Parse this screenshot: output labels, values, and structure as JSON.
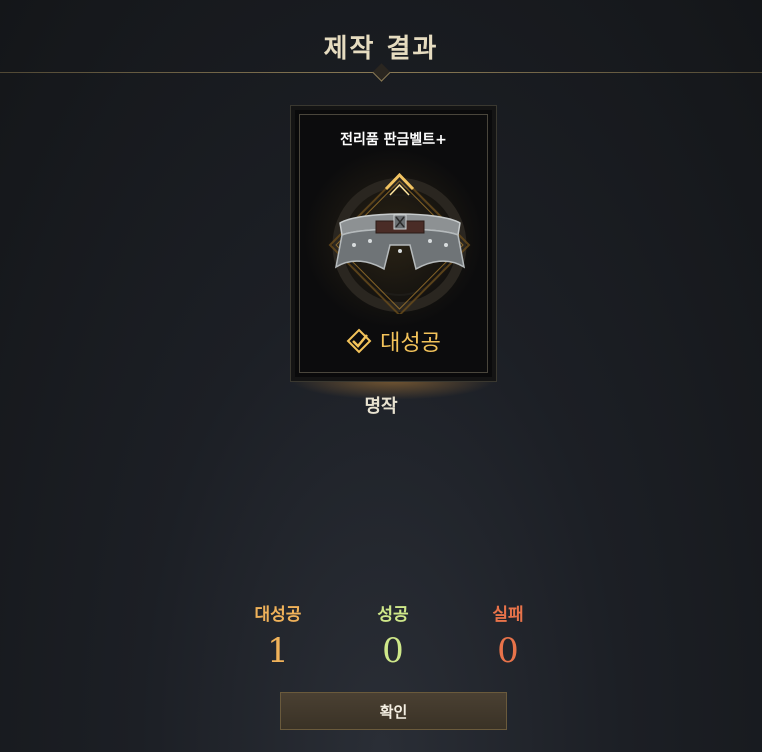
{
  "header": {
    "title": "제작 결과"
  },
  "item": {
    "name": "전리품 판금벨트+",
    "icon": "plate-belt-icon",
    "result_label": "대성공",
    "grade": "명작"
  },
  "stats": {
    "great_success": {
      "label": "대성공",
      "value": "1",
      "color": "#f0b25a"
    },
    "success": {
      "label": "성공",
      "value": "0",
      "color": "#cfe88a"
    },
    "failure": {
      "label": "실패",
      "value": "0",
      "color": "#e8734a"
    }
  },
  "actions": {
    "confirm_label": "확인"
  },
  "colors": {
    "accent_gold": "#f3c35a",
    "background": "#1c1f25"
  }
}
